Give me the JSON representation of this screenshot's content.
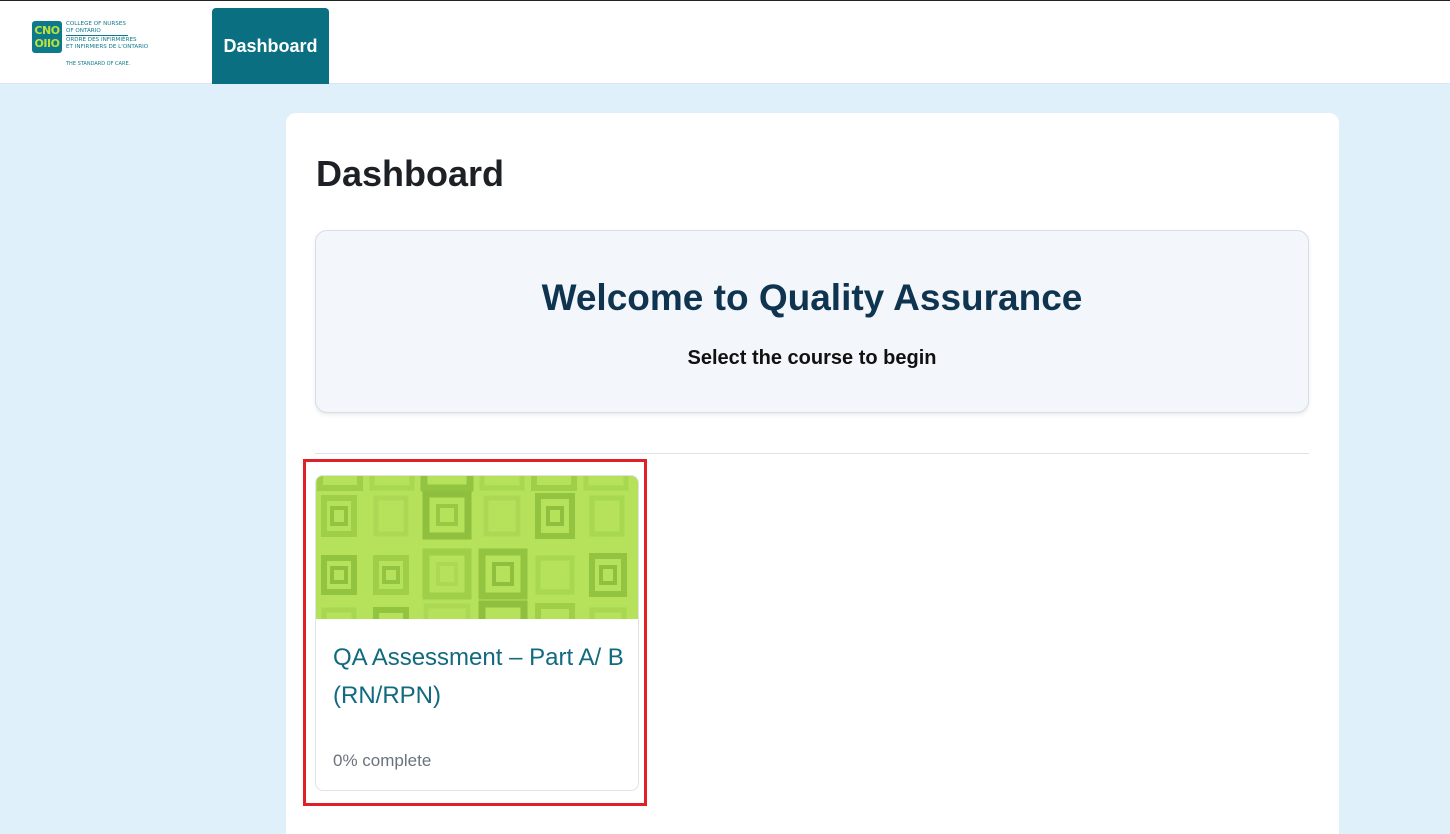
{
  "header": {
    "logo": {
      "mark": "CNO OIIO",
      "line1": "COLLEGE OF NURSES",
      "line2": "OF ONTARIO",
      "line3": "ORDRE DES INFIRMIÈRES",
      "line4": "ET INFIRMIERS DE L'ONTARIO",
      "tagline": "THE STANDARD OF CARE."
    },
    "nav": {
      "dashboard_label": "Dashboard"
    }
  },
  "main": {
    "title": "Dashboard",
    "welcome": {
      "title": "Welcome to Quality Assurance",
      "subtitle": "Select the course to begin"
    },
    "courses": [
      {
        "name": "QA Assessment – Part A/ B (RN/RPN)",
        "progress": 0,
        "progress_text": "0% complete",
        "image_color": "#b5e25a"
      }
    ]
  },
  "colors": {
    "brand_teal": "#0b6f82",
    "page_bg": "#e0f0fb",
    "highlight_red": "#e01f26",
    "course_link": "#106a80"
  }
}
